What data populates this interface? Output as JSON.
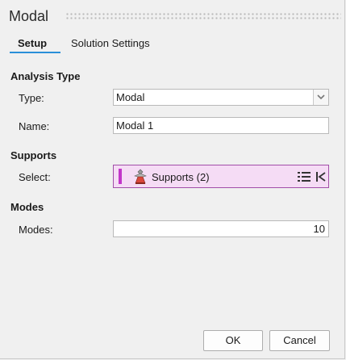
{
  "dialog": {
    "title": "Modal"
  },
  "tabs": [
    {
      "label": "Setup",
      "active": true
    },
    {
      "label": "Solution Settings",
      "active": false
    }
  ],
  "analysis_type": {
    "heading": "Analysis Type",
    "type_label": "Type:",
    "type_value": "Modal",
    "name_label": "Name:",
    "name_value": "Modal 1"
  },
  "supports": {
    "heading": "Supports",
    "select_label": "Select:",
    "selection_text": "Supports (2)",
    "icon": "support-icon",
    "accent_color": "#c236c9"
  },
  "modes": {
    "heading": "Modes",
    "modes_label": "Modes:",
    "modes_value": "10"
  },
  "buttons": {
    "ok": "OK",
    "cancel": "Cancel"
  },
  "colors": {
    "tab_underline": "#2a8fd8",
    "selection_background": "#f5dcf5"
  }
}
